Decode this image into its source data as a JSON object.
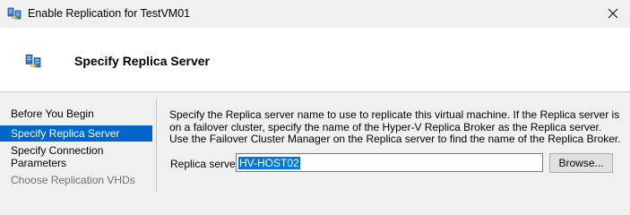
{
  "window": {
    "title": "Enable Replication for TestVM01",
    "close_icon": "close-icon"
  },
  "header": {
    "title": "Specify Replica Server",
    "icon": "replication-icon"
  },
  "sidebar": {
    "items": [
      {
        "label": "Before You Begin",
        "state": "normal"
      },
      {
        "label": "Specify Replica Server",
        "state": "selected"
      },
      {
        "label": "Specify Connection Parameters",
        "state": "normal"
      },
      {
        "label": "Choose Replication VHDs",
        "state": "disabled"
      }
    ]
  },
  "main": {
    "description": "Specify the Replica server name to use to replicate this virtual machine. If the Replica server is on a failover cluster, specify the name of the Hyper-V Replica Broker as the Replica server. Use the Failover Cluster Manager on the Replica server to find the name of the Replica Broker.",
    "replica_server_label": "Replica server:",
    "replica_server_value": "HV-HOST02",
    "browse_label": "Browse..."
  },
  "colors": {
    "selection": "#0066cc",
    "text_highlight": "#0078d7"
  }
}
